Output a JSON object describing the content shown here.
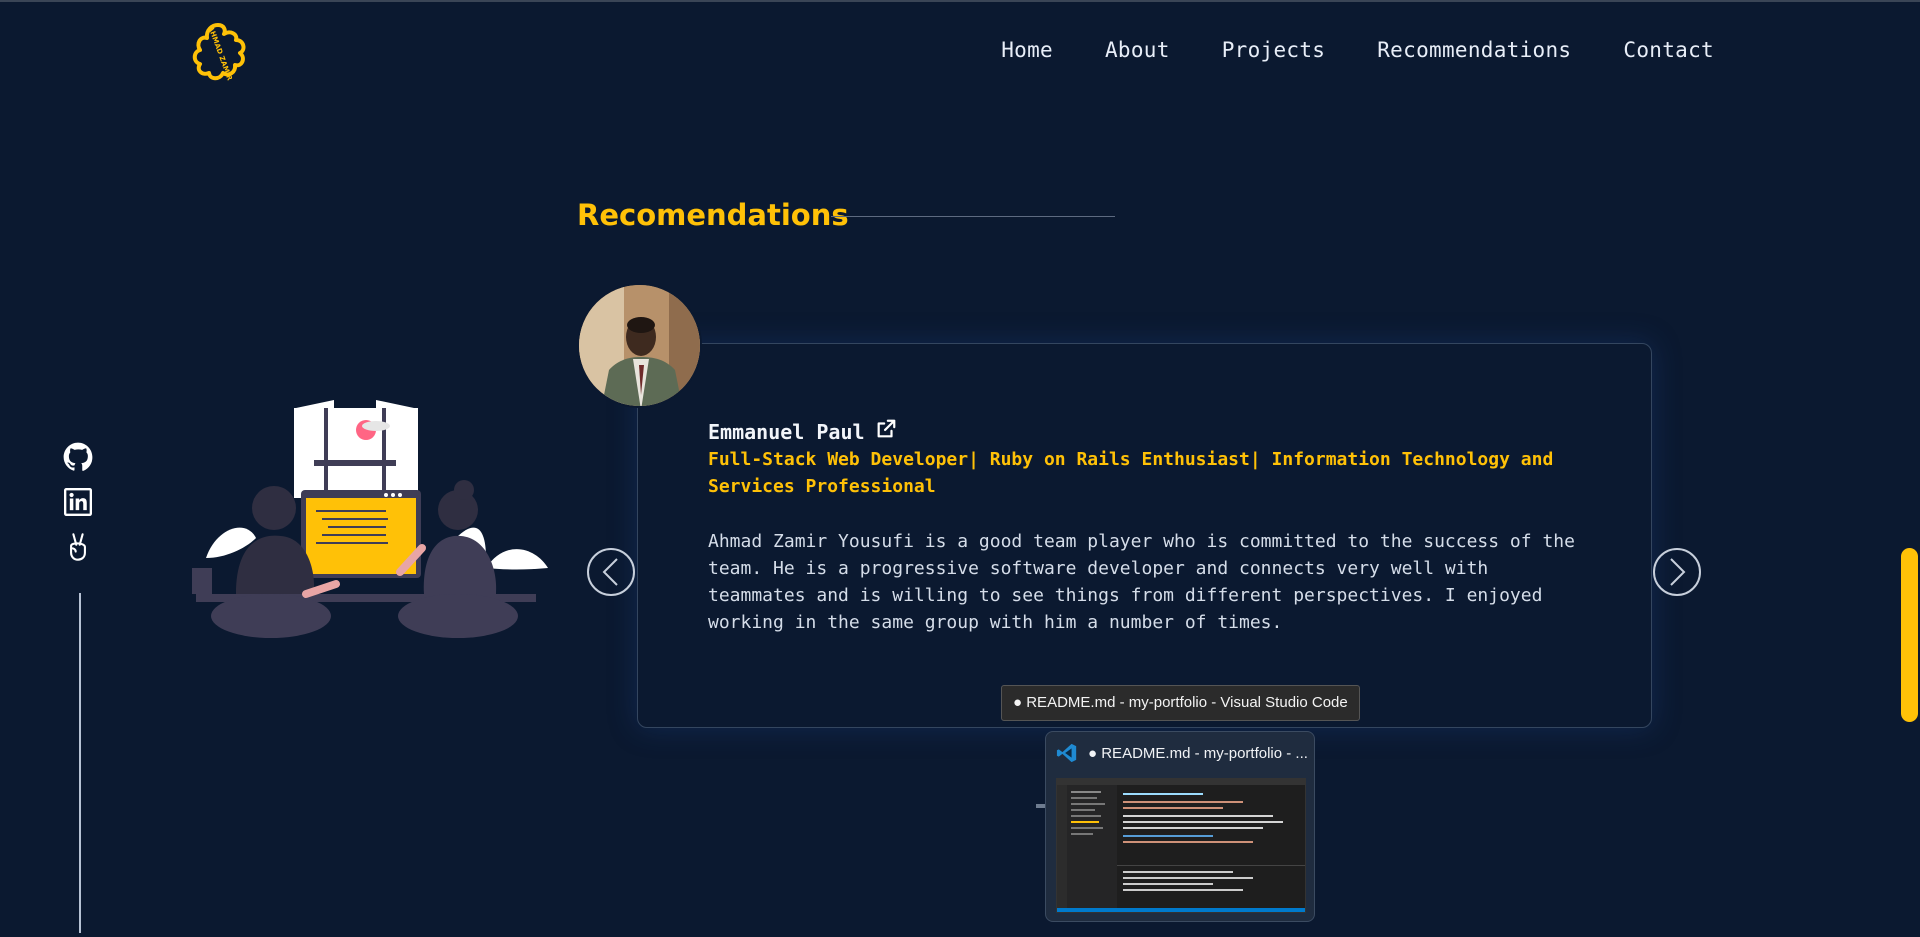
{
  "brand": {
    "logo_text": "AHMAD ZAMIR",
    "accent": "#ffc107",
    "background": "#0b1930"
  },
  "nav": {
    "items": [
      {
        "label": "Home"
      },
      {
        "label": "About"
      },
      {
        "label": "Projects"
      },
      {
        "label": "Recommendations"
      },
      {
        "label": "Contact"
      }
    ]
  },
  "social": {
    "icons": [
      "github-icon",
      "linkedin-icon",
      "angellist-icon"
    ]
  },
  "section": {
    "title": "Recomendations"
  },
  "recommendation": {
    "name": "Emmanuel Paul",
    "role": "Full-Stack Web Developer| Ruby on Rails Enthusiast| Information Technology and Services Professional",
    "text": "Ahmad Zamir Yousufi is a good team player who is committed to the success of the team. He is a progressive software developer and connects very well with teammates and is willing to see things from different perspectives. I enjoyed working in the same group with him a number of times."
  },
  "taskbar": {
    "tooltip": "● README.md - my-portfolio - Visual Studio Code",
    "preview_title": "● README.md - my-portfolio - ..."
  }
}
